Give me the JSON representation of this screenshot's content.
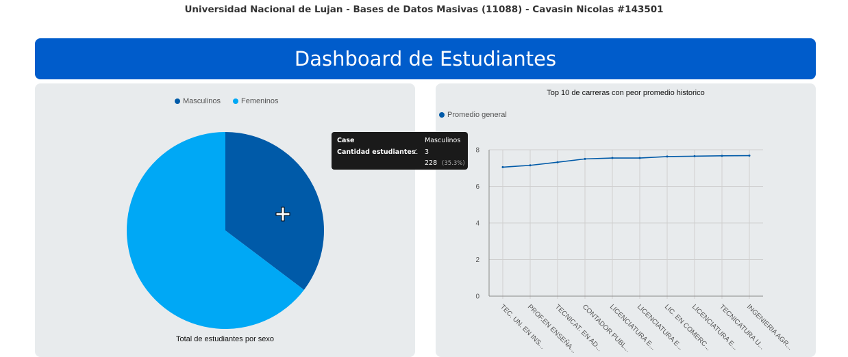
{
  "page_header": "Universidad Nacional de Lujan - Bases de Datos Masivas (11088) - Cavasin Nicolas #143501",
  "banner_title": "Dashboard de Estudiantes",
  "pie_card": {
    "title": "Total de estudiantes por sexo",
    "legend": [
      {
        "label": "Masculinos",
        "color": "#005aa8"
      },
      {
        "label": "Femeninos",
        "color": "#00a8f5"
      }
    ]
  },
  "line_card": {
    "title": "Top 10 de carreras con peor promedio historico",
    "legend": [
      {
        "label": "Promedio general",
        "color": "#005aa8"
      }
    ]
  },
  "tooltip": {
    "col1_header": "Case",
    "col2_header": "Masculinos",
    "row_label": "Cantidad estudiantes",
    "row_icon": "∠",
    "row_value": "3",
    "value2": "228",
    "percent": "(35.3%)"
  },
  "chart_data": [
    {
      "type": "pie",
      "title": "Total de estudiantes por sexo",
      "labels": [
        "Masculinos",
        "Femeninos"
      ],
      "values": [
        35.3,
        64.7
      ],
      "colors": [
        "#005aa8",
        "#00a8f5"
      ],
      "legend_position": "top"
    },
    {
      "type": "line",
      "title": "Top 10 de carreras con peor promedio historico",
      "categories": [
        "TEC. UN. EN INS...",
        "PROF.EN ENSEÑA...",
        "TECNICAT. EN AD...",
        "CONTADOR PUBL...",
        "LICENCIATURA E...",
        "LICENCIATURA E...",
        "LIC. EN COMERC...",
        "LICENCIATURA E...",
        "TECNICATURA U...",
        "INGENIERIA AGR..."
      ],
      "series": [
        {
          "name": "Promedio general",
          "color": "#005aa8",
          "values": [
            7.05,
            7.15,
            7.32,
            7.5,
            7.55,
            7.55,
            7.63,
            7.65,
            7.67,
            7.68
          ]
        }
      ],
      "ylim": [
        0,
        8
      ],
      "yticks": [
        0,
        2,
        4,
        6,
        8
      ],
      "grid": true,
      "legend_position": "top-left"
    }
  ]
}
